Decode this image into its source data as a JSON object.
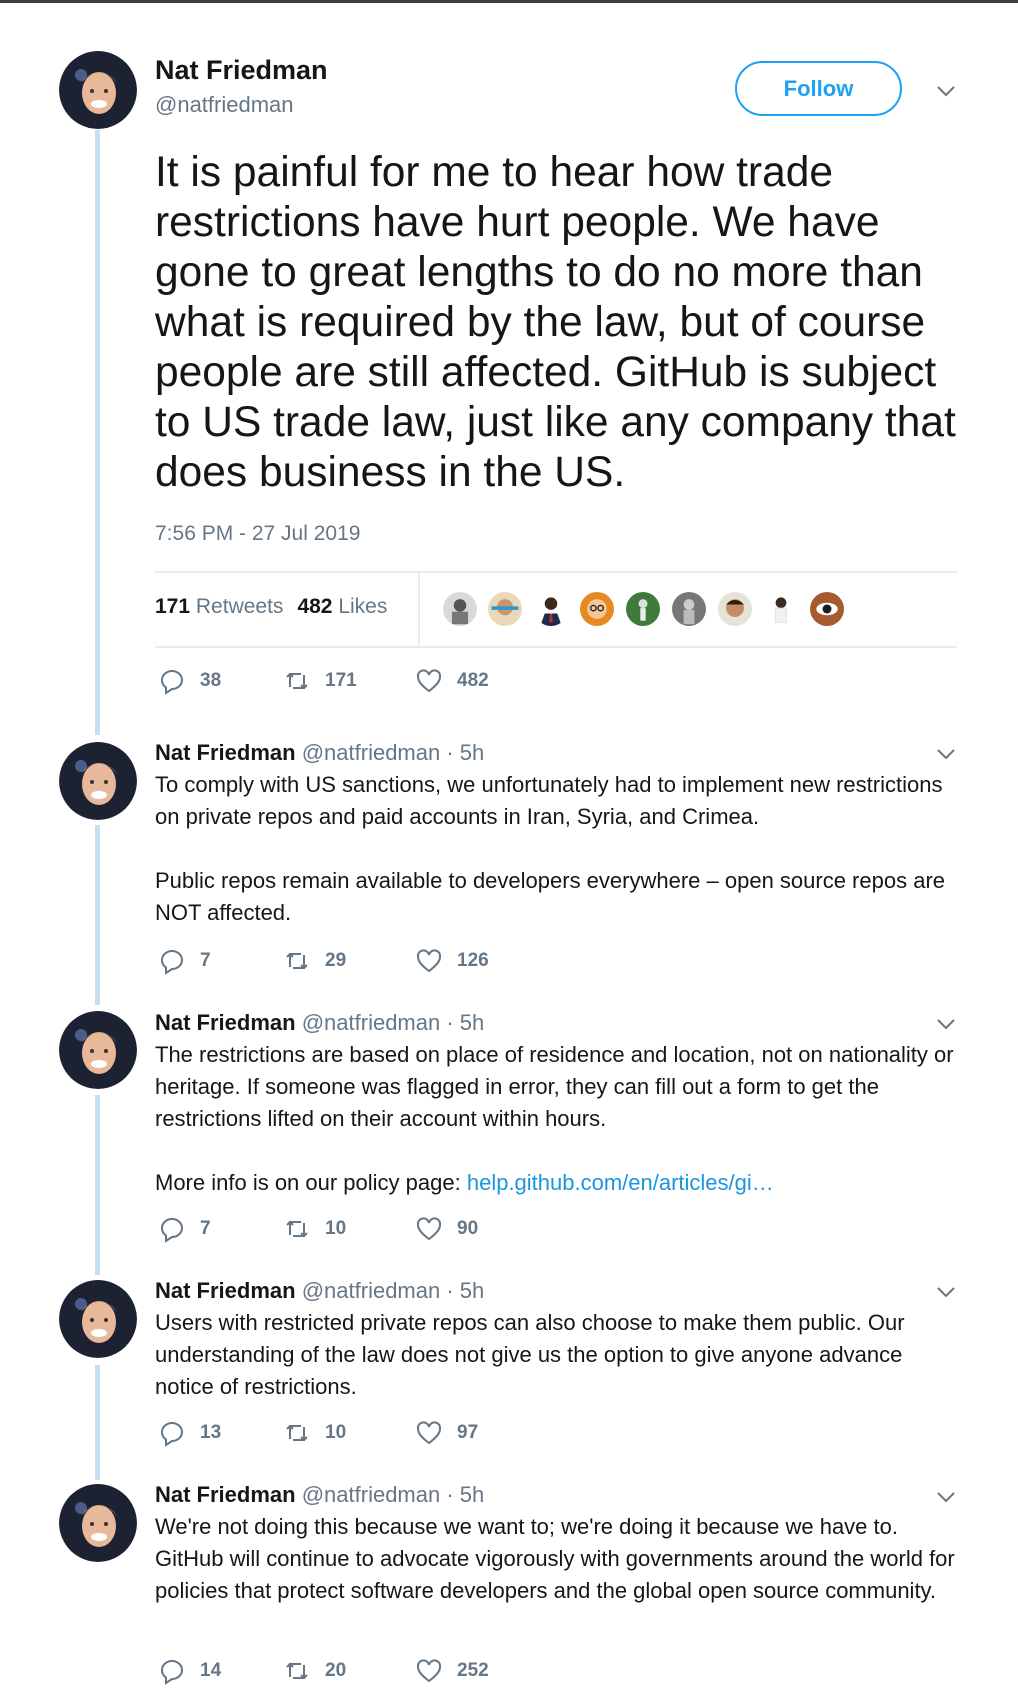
{
  "main_tweet": {
    "name": "Nat Friedman",
    "handle": "@natfriedman",
    "follow_label": "Follow",
    "text": "It is painful for me to hear how trade restrictions have hurt people. We have gone to great lengths to do no more than what is required by the law, but of course people are still affected. GitHub is subject to US trade law, just like any company that does business in the US.",
    "timestamp": "7:56 PM - 27 Jul 2019",
    "retweets_count": "171",
    "retweets_label": "Retweets",
    "likes_count": "482",
    "likes_label": "Likes",
    "reply_count": "38",
    "retweet_count": "171",
    "like_count": "482"
  },
  "icons": {
    "reply": "speech-bubble-icon",
    "retweet": "retweet-icon",
    "like": "heart-icon",
    "menu": "chevron-down-icon"
  },
  "colors": {
    "accent": "#1da1f2",
    "link": "#1b95e0",
    "thread_line": "#c4dff2",
    "muted": "#657786"
  },
  "replies": [
    {
      "name": "Nat Friedman",
      "meta": "@natfriedman · 5h",
      "paragraphs": [
        "To comply with US sanctions, we unfortunately had to implement new restrictions on private repos and paid accounts in Iran, Syria, and Crimea.",
        "",
        "Public repos remain available to developers everywhere – open source repos are NOT affected."
      ],
      "reply_count": "7",
      "retweet_count": "29",
      "like_count": "126"
    },
    {
      "name": "Nat Friedman",
      "meta": "@natfriedman · 5h",
      "paragraphs": [
        "The restrictions are based on place of residence and location, not on nationality or heritage. If someone was flagged in error, they can fill out a form to get the restrictions lifted on their account within hours.",
        ""
      ],
      "more_info_text": "More info is on our policy page: ",
      "link_text": "help.github.com/en/articles/gi…",
      "reply_count": "7",
      "retweet_count": "10",
      "like_count": "90"
    },
    {
      "name": "Nat Friedman",
      "meta": "@natfriedman · 5h",
      "paragraphs": [
        "Users with restricted private repos can also choose to make them public. Our understanding of the law does not give us the option to give anyone advance notice of restrictions."
      ],
      "reply_count": "13",
      "retweet_count": "10",
      "like_count": "97"
    },
    {
      "name": "Nat Friedman",
      "meta": "@natfriedman · 5h",
      "paragraphs": [
        "We're not doing this because we want to; we're doing it because we have to. GitHub will continue to advocate vigorously with governments around the world for policies that protect software developers and the global open source community."
      ],
      "reply_count": "14",
      "retweet_count": "20",
      "like_count": "252"
    }
  ]
}
